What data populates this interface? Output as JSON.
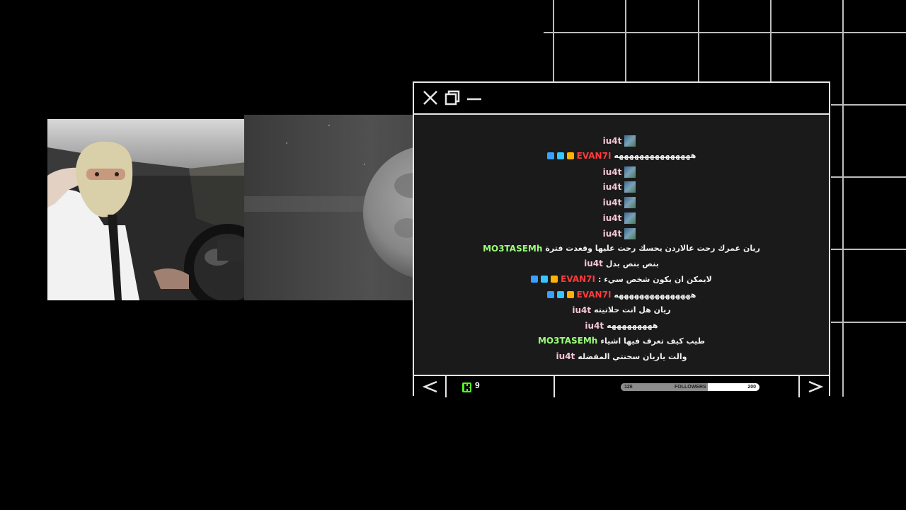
{
  "chat": {
    "messages": [
      {
        "user": "iu4t",
        "user_class": "u-iu4t",
        "text": "",
        "badges": [],
        "avatar": true
      },
      {
        "user": "EVAN7I",
        "user_class": "u-evan",
        "text": "هههههههههههههههه",
        "badges": [
          "pickaxe",
          "cube",
          "crown"
        ],
        "avatar": false
      },
      {
        "user": "iu4t",
        "user_class": "u-iu4t",
        "text": "",
        "badges": [],
        "avatar": true
      },
      {
        "user": "iu4t",
        "user_class": "u-iu4t",
        "text": "",
        "badges": [],
        "avatar": true
      },
      {
        "user": "iu4t",
        "user_class": "u-iu4t",
        "text": "",
        "badges": [],
        "avatar": true
      },
      {
        "user": "iu4t",
        "user_class": "u-iu4t",
        "text": "",
        "badges": [],
        "avatar": true
      },
      {
        "user": "iu4t",
        "user_class": "u-iu4t",
        "text": "",
        "badges": [],
        "avatar": true
      },
      {
        "user": "MO3TASEMh",
        "user_class": "u-mo",
        "text": "ريان عمرك رحت عالاردن يحسك رحت عليها وقعدت فترة",
        "badges": [],
        "avatar": false
      },
      {
        "user": "iu4t",
        "user_class": "u-iu4t",
        "text": "بنص بنص بدل",
        "badges": [],
        "avatar": false
      },
      {
        "user": "EVAN7I",
        "user_class": "u-evan",
        "text": "لايمكن ان يكون شخص سيء :",
        "badges": [
          "pickaxe",
          "cube",
          "crown"
        ],
        "avatar": false
      },
      {
        "user": "EVAN7I",
        "user_class": "u-evan",
        "text": "هههههههههههههههه",
        "badges": [
          "pickaxe",
          "cube",
          "crown"
        ],
        "avatar": false
      },
      {
        "user": "iu4t",
        "user_class": "u-iu4t",
        "text": "ريان هل انت حلاتيته",
        "badges": [],
        "avatar": false
      },
      {
        "user": "iu4t",
        "user_class": "u-iu4t",
        "text": "هههههههههه",
        "badges": [],
        "avatar": false
      },
      {
        "user": "MO3TASEMh",
        "user_class": "u-mo",
        "text": "طيب كيف تعرف فيها اشياء",
        "badges": [],
        "avatar": false
      },
      {
        "user": "iu4t",
        "user_class": "u-iu4t",
        "text": "والت ياريان سحنتي المفضله",
        "badges": [],
        "avatar": false
      }
    ]
  },
  "footer": {
    "kick_icon": "kick-logo-icon",
    "viewer_count": "9",
    "followers_current": "126",
    "followers_label": "FOLLOWERS",
    "followers_goal": "200",
    "followers_progress": 0.63,
    "prev_icon": "chevron-left-icon",
    "next_icon": "chevron-right-icon"
  },
  "titlebar": {
    "icons": [
      "close-icon",
      "restore-icon",
      "minimize-icon"
    ]
  },
  "colors": {
    "kick_green": "#53fc18",
    "evan_red": "#ff3b3b",
    "mo_green": "#9cff7a",
    "iu4t_pink": "#f4c5d8",
    "frame": "#e6e6e6"
  }
}
